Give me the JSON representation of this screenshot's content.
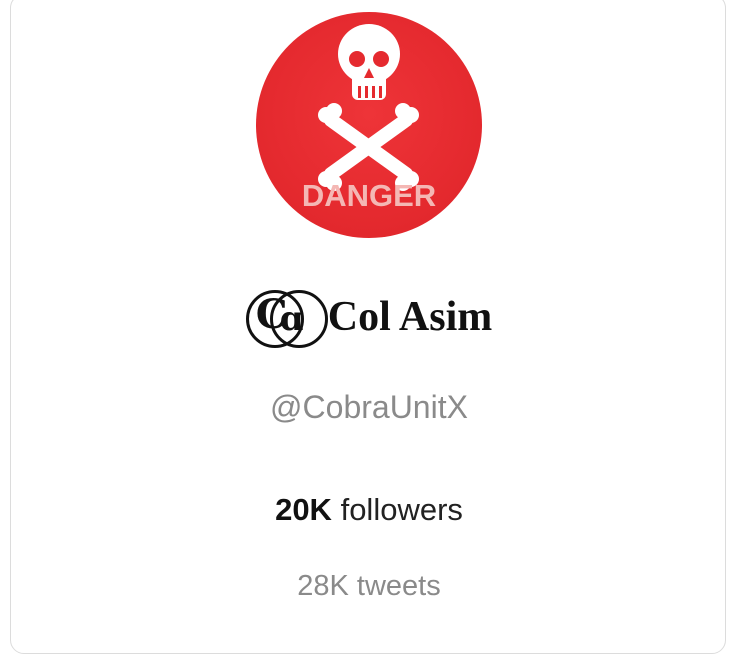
{
  "profile": {
    "avatar_icon": "skull-crossbones-icon",
    "avatar_bg_color": "#e52a2f",
    "avatar_text": "DANGER",
    "name_prefix_letters": "C",
    "display_name": "Col Asim",
    "handle": "@CobraUnitX",
    "followers_count": "20K",
    "followers_label": "followers",
    "tweets_text": "28K tweets"
  }
}
